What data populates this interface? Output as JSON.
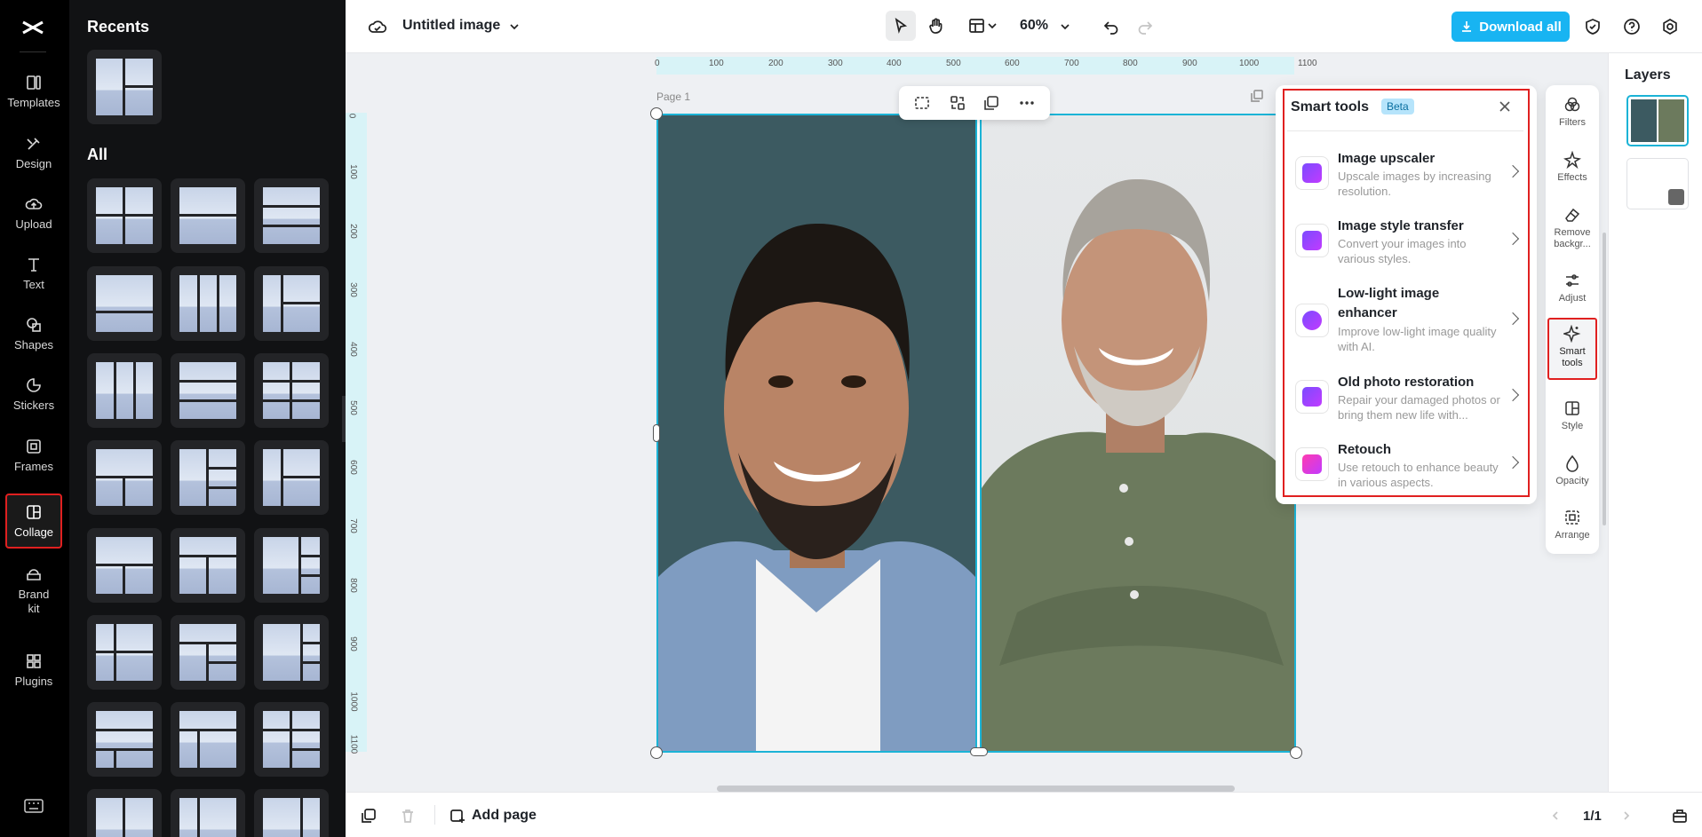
{
  "rail": {
    "items": [
      {
        "label": "Templates",
        "icon": "templates-icon"
      },
      {
        "label": "Design",
        "icon": "design-icon"
      },
      {
        "label": "Upload",
        "icon": "upload-icon"
      },
      {
        "label": "Text",
        "icon": "text-icon"
      },
      {
        "label": "Shapes",
        "icon": "shapes-icon"
      },
      {
        "label": "Stickers",
        "icon": "stickers-icon"
      },
      {
        "label": "Frames",
        "icon": "frames-icon"
      },
      {
        "label": "Collage",
        "icon": "collage-icon",
        "active": true
      },
      {
        "label": "Brand\nkit",
        "icon": "brand-kit-icon"
      },
      {
        "label": "Plugins",
        "icon": "plugins-icon"
      }
    ]
  },
  "panel": {
    "recents_heading": "Recents",
    "all_heading": "All"
  },
  "topbar": {
    "doc_title": "Untitled image",
    "zoom": "60%",
    "download_label": "Download all"
  },
  "ruler": {
    "h_ticks": [
      "0",
      "100",
      "200",
      "300",
      "400",
      "500",
      "600",
      "700",
      "800",
      "900",
      "1000",
      "1100"
    ],
    "v_ticks": [
      "0",
      "100",
      "200",
      "300",
      "400",
      "500",
      "600",
      "700",
      "800",
      "900",
      "1000",
      "1100"
    ]
  },
  "canvas": {
    "page_label": "Page 1"
  },
  "smart_tools": {
    "title": "Smart tools",
    "badge": "Beta",
    "tools": [
      {
        "name": "Image upscaler",
        "desc": "Upscale images by increasing resolution."
      },
      {
        "name": "Image style transfer",
        "desc": "Convert your images into various styles."
      },
      {
        "name": "Low-light image enhancer",
        "desc": "Improve low-light image quality with AI."
      },
      {
        "name": "Old photo restoration",
        "desc": "Repair your damaged photos or bring them new life with..."
      },
      {
        "name": "Retouch",
        "desc": "Use retouch to enhance beauty in various aspects."
      }
    ]
  },
  "strip": {
    "items": [
      {
        "label": "Filters"
      },
      {
        "label": "Effects"
      },
      {
        "label": "Remove backgr..."
      },
      {
        "label": "Adjust"
      },
      {
        "label": "Smart tools",
        "active": true
      },
      {
        "label": "Style"
      },
      {
        "label": "Opacity"
      },
      {
        "label": "Arrange"
      }
    ]
  },
  "layers": {
    "title": "Layers"
  },
  "bottombar": {
    "add_page_label": "Add page",
    "pager": "1/1"
  }
}
